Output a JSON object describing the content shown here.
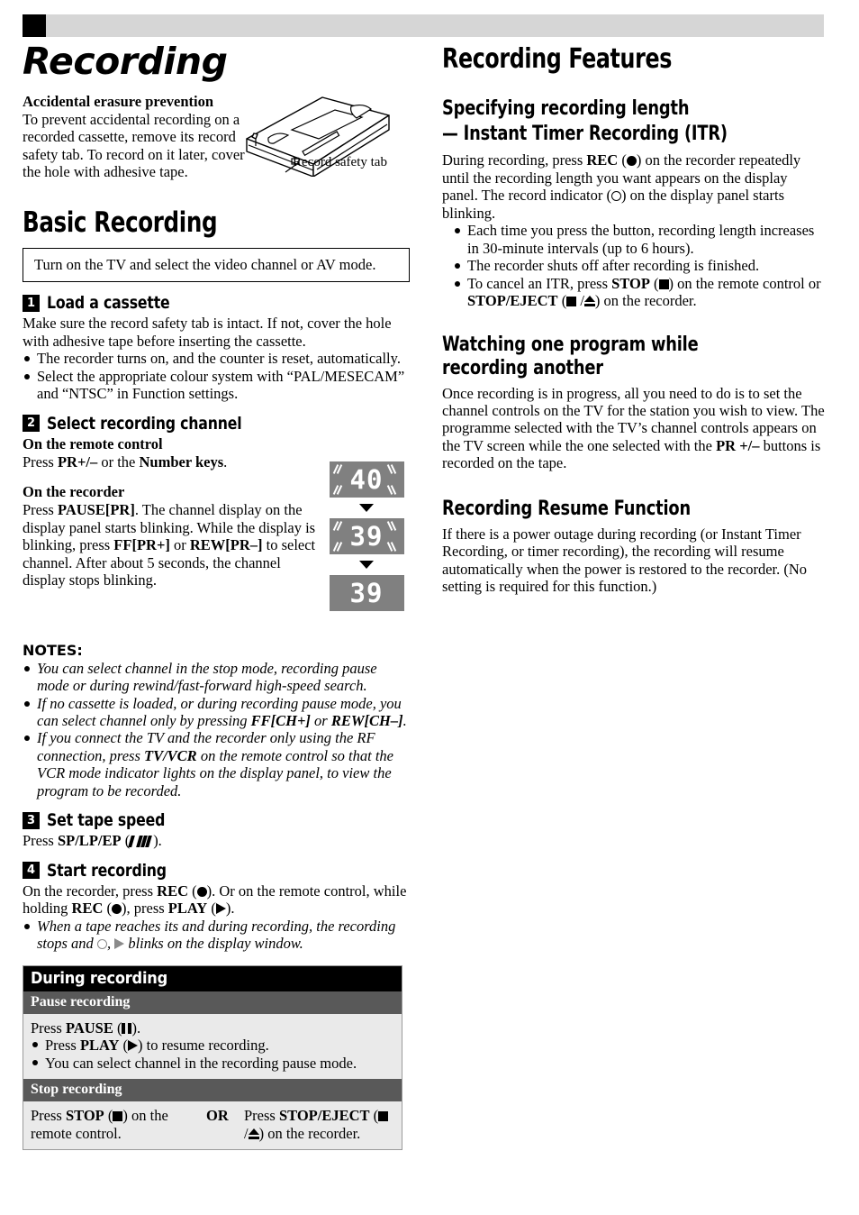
{
  "header": {
    "marker_color": "#000000",
    "band_color": "#d6d6d6"
  },
  "left_column": {
    "page_title": "Recording",
    "erasure": {
      "heading": "Accidental erasure prevention",
      "body": "To prevent accidental recording on a recorded cassette, remove its record safety tab. To record on it later, cover the hole with adhesive tape.",
      "figure_caption": "Record safety tab"
    },
    "basic_recording": {
      "heading": "Basic Recording",
      "callout": "Turn on the TV and select the video channel or AV mode.",
      "steps": [
        {
          "number": "1",
          "label": "Load a cassette",
          "body": "Make sure the record safety tab is intact. If not, cover the hole with adhesive tape before inserting the cassette.",
          "bullets": [
            "The recorder turns on, and the counter is reset, automatically.",
            "Select the appropriate colour system with “PAL/MESECAM” and “NTSC” in Function settings."
          ]
        },
        {
          "number": "2",
          "label": "Select recording channel",
          "sub1_heading": "On the remote control",
          "sub1_body_pre": "Press ",
          "sub1_body_b1": "PR+/–",
          "sub1_body_mid": " or the ",
          "sub1_body_b2": "Number keys",
          "sub1_body_post": ".",
          "sub2_heading": "On the recorder",
          "sub2_body_1": "Press ",
          "sub2_body_b1": "PAUSE[PR]",
          "sub2_body_2": ". The channel display on the display panel starts blinking. While the display is blinking, press ",
          "sub2_body_b2": "FF[PR+]",
          "sub2_body_3": " or ",
          "sub2_body_b3": "REW[PR–]",
          "sub2_body_4": " to select channel. After about 5 seconds, the channel display stops blinking."
        },
        {
          "number": "3",
          "label": "Set tape speed",
          "body_pre": "Press ",
          "body_bold": "SP/LP/EP",
          "body_post": ")."
        },
        {
          "number": "4",
          "label": "Start recording",
          "body_1": "On the recorder, press ",
          "body_b1": "REC",
          "body_2": "). Or on the remote control, while holding ",
          "body_b2": "REC",
          "body_3": "), press ",
          "body_b3": "PLAY",
          "body_4": ").",
          "bullet_1": "When a tape reaches its and during recording, the recording",
          "bullet_2a": "stops and",
          "bullet_2b": ",",
          "bullet_2c": "blinks on the display window."
        }
      ],
      "display_panels": [
        {
          "value": "40",
          "blinking": true
        },
        {
          "value": "39",
          "blinking": true
        },
        {
          "value": "39",
          "blinking": false
        }
      ]
    },
    "notes": {
      "heading": "NOTES:",
      "items": [
        "You can select channel in the stop mode, recording pause mode or during rewind/fast-forward high-speed search.",
        "If no cassette is loaded, or during recording pause mode, you can select channel only by pressing FF[CH+] or REW[CH–].",
        "If you connect the TV and the recorder only using the RF connection, press TV/VCR on the remote control so that the VCR mode indicator lights on the display panel, to view the program to be recorded."
      ],
      "item2_pre": "If no cassette is loaded, or during recording pause mode, you can select channel only by pressing ",
      "item2_b1": "FF[CH+]",
      "item2_mid": " or ",
      "item2_b2": "REW[CH–]",
      "item2_post": ".",
      "item3_pre": "If you connect the TV and the recorder only using the RF connection, press ",
      "item3_b1": "TV/VCR",
      "item3_post": " on the remote control so that the VCR mode indicator lights on the display panel, to view the program to be recorded."
    },
    "during_recording_table": {
      "title": "During recording",
      "rows": [
        {
          "subhead": "Pause recording",
          "line_pre": "Press ",
          "line_bold": "PAUSE",
          "line_post": ").",
          "bullets": [
            {
              "pre": "Press ",
              "bold": "PLAY",
              "post": ") to resume recording."
            },
            {
              "pre": "You can select channel in the recording pause mode.",
              "bold": "",
              "post": ""
            }
          ]
        }
      ],
      "stop_subhead": "Stop recording",
      "stop_left_pre": "Press ",
      "stop_left_bold": "STOP",
      "stop_left_post": ") on the remote control.",
      "stop_or": "OR",
      "stop_right_pre": "Press ",
      "stop_right_bold": "STOP/EJECT",
      "stop_right_post": ") on the recorder."
    }
  },
  "right_column": {
    "heading": "Recording Features",
    "sections": [
      {
        "heading_line1": "Specifying recording length",
        "heading_line2": "— Instant Timer Recording (ITR)",
        "body_1": "During recording, press ",
        "body_b1": "REC",
        "body_2": ") on the recorder repeatedly until the recording length you want appears on the display panel. The record indicator (",
        "body_3": ") on the display panel starts blinking.",
        "bullets": [
          "Each time you press the button, recording length increases in 30-minute intervals (up to 6 hours).",
          "The recorder shuts off after recording is finished."
        ],
        "bullet3_pre": "To cancel an ITR, press ",
        "bullet3_b1": "STOP",
        "bullet3_mid": ") on the remote control or ",
        "bullet3_b2": "STOP/EJECT",
        "bullet3_post": ") on the recorder."
      },
      {
        "heading": "Watching one program while recording another",
        "body_1": "Once recording is in progress, all you need to do is to set the channel controls on the TV for the station you wish to view. The programme selected with the TV’s channel controls appears on the TV screen while the one selected with the ",
        "body_b1": "PR +/–",
        "body_2": " buttons is recorded on the tape."
      },
      {
        "heading": "Recording Resume Function",
        "body": "If there is a power outage during recording (or Instant Timer Recording, or timer recording), the recording will resume automatically when the power is restored to the recorder. (No setting is required for this function.)"
      }
    ]
  }
}
